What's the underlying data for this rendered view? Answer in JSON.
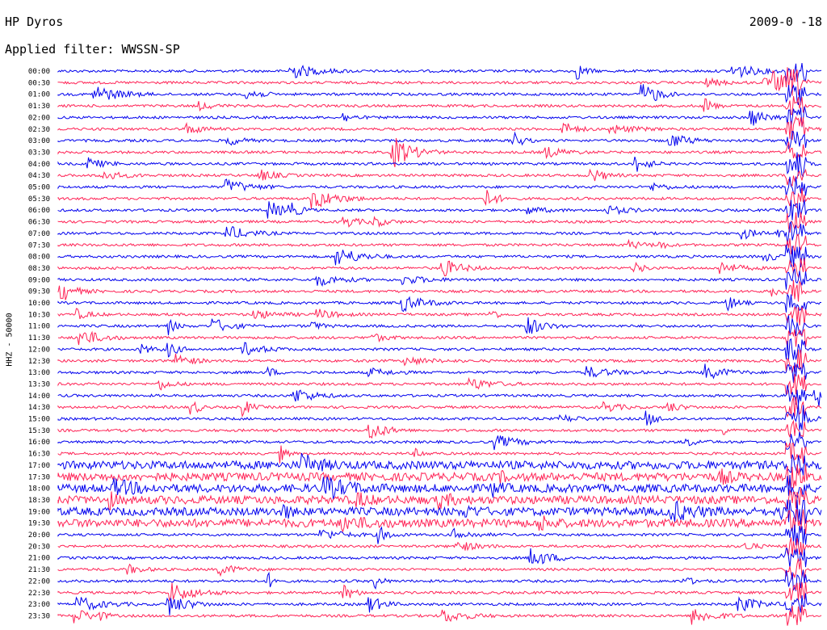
{
  "header": {
    "station": "HP Dyros",
    "filter": "Applied filter: WWSSN-SP",
    "date": "2009-0 -18"
  },
  "chart_data": {
    "type": "line",
    "ylabel": "HHZ - 50000",
    "row_labels": [
      "00:00",
      "00:30",
      "01:00",
      "01:30",
      "02:00",
      "02:30",
      "03:00",
      "03:30",
      "04:00",
      "04:30",
      "05:00",
      "05:30",
      "06:00",
      "06:30",
      "07:00",
      "07:30",
      "08:00",
      "08:30",
      "09:00",
      "09:30",
      "10:00",
      "10:30",
      "11:00",
      "11:30",
      "12:00",
      "12:30",
      "13:00",
      "13:30",
      "14:00",
      "14:30",
      "15:00",
      "15:30",
      "16:00",
      "16:30",
      "17:00",
      "17:30",
      "18:00",
      "18:30",
      "19:00",
      "19:30",
      "20:00",
      "20:30",
      "21:00",
      "21:30",
      "22:00",
      "22:30",
      "23:00",
      "23:30"
    ],
    "colors": [
      "#0000ee",
      "#ff2255"
    ]
  }
}
